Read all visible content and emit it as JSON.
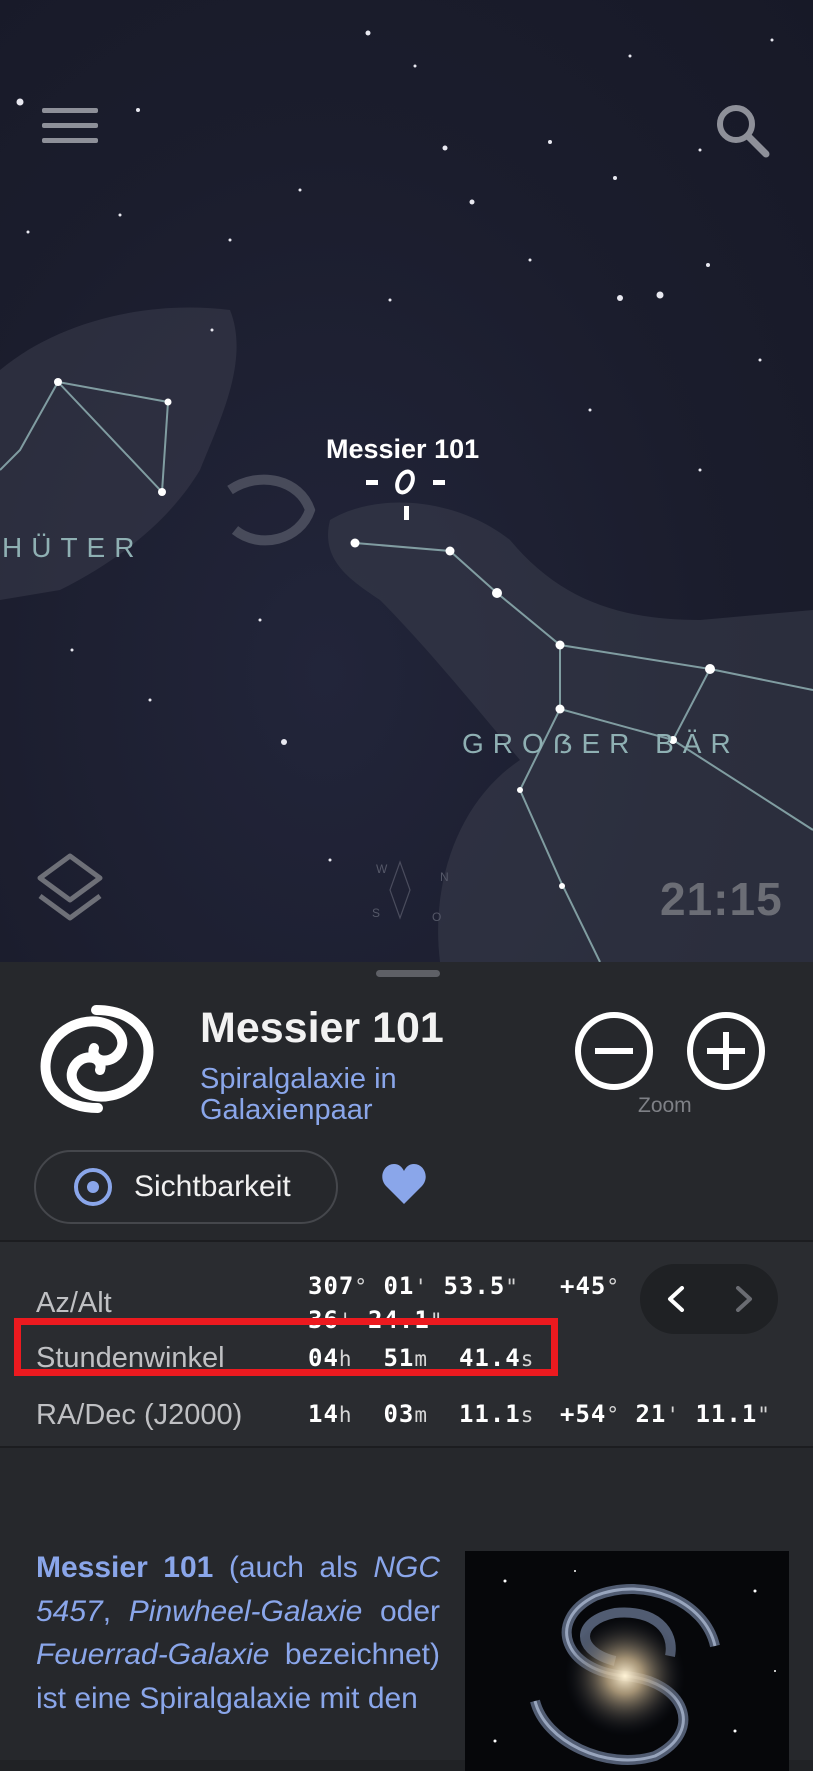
{
  "sky": {
    "object_label": "Messier 101",
    "constellations": [
      "HÜTER",
      "GROẞER BÄR"
    ],
    "time": "21:15",
    "compass": [
      "W",
      "N",
      "S",
      "O"
    ]
  },
  "icons": {
    "menu": "menu-icon",
    "search": "search-icon",
    "layers": "layers-icon",
    "galaxy": "galaxy-icon",
    "visibility": "target-icon",
    "favorite": "heart-icon",
    "prev": "chevron-left-icon",
    "next": "chevron-right-icon"
  },
  "sheet": {
    "title": "Messier 101",
    "subtitle": "Spiralgalaxie in Galaxienpaar",
    "zoom_label": "Zoom",
    "visibility_label": "Sichtbarkeit"
  },
  "coords": {
    "az_alt": {
      "label": "Az/Alt",
      "az": {
        "deg": "307",
        "min": "01",
        "sec": "53.5"
      },
      "alt": {
        "deg": "+45",
        "min": "36",
        "sec": "24.1"
      }
    },
    "hour_angle": {
      "label": "Stundenwinkel",
      "h": "04",
      "m": "51",
      "s": "41.4"
    },
    "ra_dec": {
      "label": "RA/Dec (J2000)",
      "ra": {
        "h": "14",
        "m": "03",
        "s": "11.1"
      },
      "dec": {
        "deg": "+54",
        "min": "21",
        "sec": "11.1"
      }
    },
    "units": {
      "deg": "°",
      "min": "'",
      "sec": "\"",
      "h": "h",
      "m": "m",
      "s": "s"
    }
  },
  "description": {
    "name": "Messier 101",
    "t1": " (auch als ",
    "alias1": "NGC 5457",
    "t2": ", ",
    "alias2": "Pinwheel-Galaxie",
    "t3": " oder ",
    "alias3": "Feuerrad-Galaxie",
    "t4": " bezeichnet) ist eine Spiralgalaxie mit den"
  },
  "colors": {
    "accent": "#8aa6ea",
    "highlight": "#ec1a1f",
    "sheet_bg": "#26282c",
    "sky_bg": "#1b1d2d"
  }
}
